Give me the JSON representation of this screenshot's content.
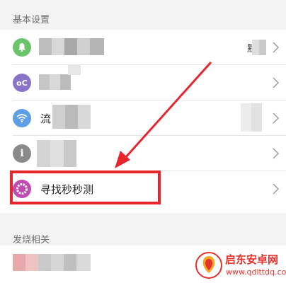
{
  "sections": {
    "basic": {
      "header": "基本设置"
    },
    "heat": {
      "header": "发烧相关"
    }
  },
  "rows": [
    {
      "icon": "bell-icon",
      "label": "",
      "trailing": "默",
      "color": "#6ac46a"
    },
    {
      "icon": "oc-icon",
      "label": "",
      "trailing": "",
      "color": "#8a74c9"
    },
    {
      "icon": "wifi-icon",
      "label": "流",
      "trailing": "",
      "color": "#5c9ee8"
    },
    {
      "icon": "info-icon",
      "label": "",
      "trailing": "",
      "color": "#8a8a8a"
    },
    {
      "icon": "donut-icon",
      "label": "寻找秒秒测",
      "trailing": "",
      "color": "#c14bb0"
    }
  ],
  "watermark": {
    "title": "启东安卓网",
    "url": "www.qdlttdq.com"
  },
  "colors": {
    "highlight": "#e8242d",
    "header_bg": "#f3f3f3"
  }
}
